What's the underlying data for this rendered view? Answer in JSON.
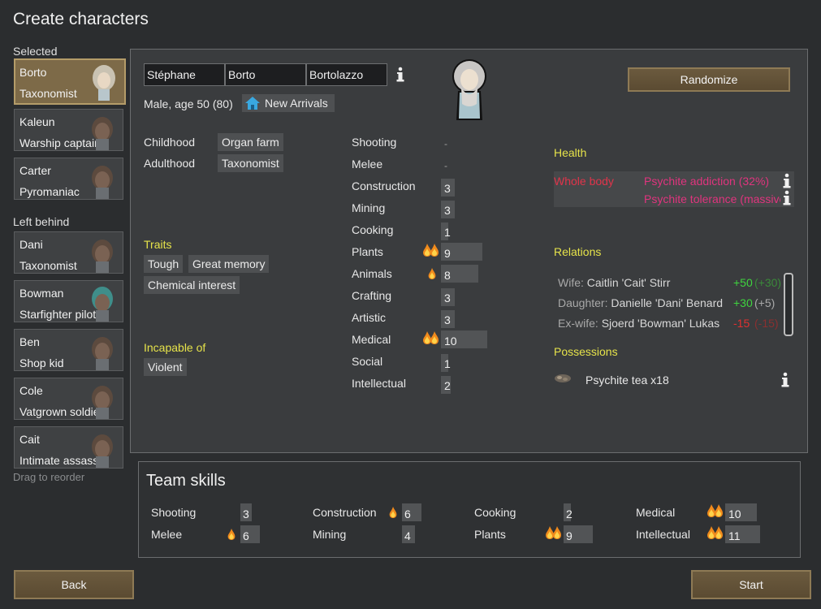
{
  "window": {
    "title": "Create characters"
  },
  "sections": {
    "selected": "Selected",
    "left_behind": "Left behind",
    "drag_hint": "Drag to reorder"
  },
  "pawns_selected": [
    {
      "name": "Borto",
      "role": "Taxonomist"
    },
    {
      "name": "Kaleun",
      "role": "Warship captain"
    },
    {
      "name": "Carter",
      "role": "Pyromaniac"
    }
  ],
  "pawns_left": [
    {
      "name": "Dani",
      "role": "Taxonomist"
    },
    {
      "name": "Bowman",
      "role": "Starfighter pilot"
    },
    {
      "name": "Ben",
      "role": "Shop kid"
    },
    {
      "name": "Cole",
      "role": "Vatgrown soldier"
    },
    {
      "name": "Cait",
      "role": "Intimate assassin"
    }
  ],
  "character": {
    "first_name": "Stéphane",
    "nick_name": "Borto",
    "last_name": "Bortolazzo",
    "description": "Male, age 50 (80)",
    "faction": "New Arrivals",
    "childhood_label": "Childhood",
    "childhood": "Organ farm",
    "adulthood_label": "Adulthood",
    "adulthood": "Taxonomist",
    "traits_label": "Traits",
    "traits": [
      "Tough",
      "Great memory",
      "Chemical interest"
    ],
    "incapable_label": "Incapable of",
    "incapable": [
      "Violent"
    ]
  },
  "skills": [
    {
      "name": "Shooting",
      "value": "-",
      "passion": 0
    },
    {
      "name": "Melee",
      "value": "-",
      "passion": 0
    },
    {
      "name": "Construction",
      "value": "3",
      "passion": 0
    },
    {
      "name": "Mining",
      "value": "3",
      "passion": 0
    },
    {
      "name": "Cooking",
      "value": "1",
      "passion": 0
    },
    {
      "name": "Plants",
      "value": "9",
      "passion": 2
    },
    {
      "name": "Animals",
      "value": "8",
      "passion": 1
    },
    {
      "name": "Crafting",
      "value": "3",
      "passion": 0
    },
    {
      "name": "Artistic",
      "value": "3",
      "passion": 0
    },
    {
      "name": "Medical",
      "value": "10",
      "passion": 2
    },
    {
      "name": "Social",
      "value": "1",
      "passion": 0
    },
    {
      "name": "Intellectual",
      "value": "2",
      "passion": 0
    }
  ],
  "health": {
    "label": "Health",
    "part": "Whole body",
    "conditions": [
      "Psychite addiction (32%)",
      "Psychite tolerance (massive)"
    ]
  },
  "relations": {
    "label": "Relations",
    "items": [
      {
        "relation": "Wife:",
        "name": "Caitlin 'Cait' Stirr",
        "opinion": "+50",
        "their": "(+30)"
      },
      {
        "relation": "Daughter:",
        "name": "Danielle 'Dani' Benard",
        "opinion": "+30",
        "their": "(+5)"
      },
      {
        "relation": "Ex-wife:",
        "name": "Sjoerd 'Bowman' Lukas",
        "opinion": "-15",
        "their": "(-15)"
      }
    ]
  },
  "possessions": {
    "label": "Possessions",
    "items": [
      "Psychite tea x18"
    ]
  },
  "buttons": {
    "randomize": "Randomize",
    "back": "Back",
    "start": "Start"
  },
  "team_skills": {
    "title": "Team skills",
    "items": [
      {
        "name": "Shooting",
        "value": "3",
        "passion": 0
      },
      {
        "name": "Melee",
        "value": "6",
        "passion": 1
      },
      {
        "name": "Construction",
        "value": "6",
        "passion": 1
      },
      {
        "name": "Mining",
        "value": "4",
        "passion": 0
      },
      {
        "name": "Cooking",
        "value": "2",
        "passion": 0
      },
      {
        "name": "Plants",
        "value": "9",
        "passion": 2
      },
      {
        "name": "Medical",
        "value": "10",
        "passion": 2
      },
      {
        "name": "Intellectual",
        "value": "11",
        "passion": 2
      }
    ]
  },
  "colors": {
    "button_brown": "#6b5a3e",
    "panel": "#3a3c3e",
    "heading_yellow": "#e6e34a",
    "health_red": "#e0344a"
  }
}
